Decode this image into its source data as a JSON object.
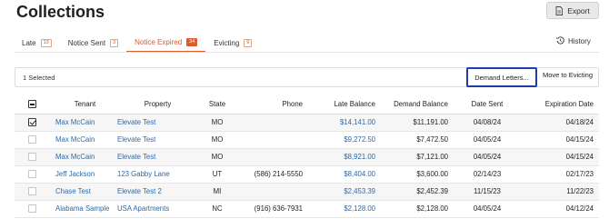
{
  "page": {
    "title": "Collections"
  },
  "toolbar": {
    "export_label": "Export",
    "export_icon": "document-export-icon"
  },
  "tabs": [
    {
      "label": "Late",
      "count": "13",
      "active": false
    },
    {
      "label": "Notice Sent",
      "count": "3",
      "active": false
    },
    {
      "label": "Notice Expired",
      "count": "34",
      "active": true
    },
    {
      "label": "Evicting",
      "count": "9",
      "active": false
    }
  ],
  "history": {
    "label": "History",
    "icon": "history-icon"
  },
  "actions": {
    "selected_text": "1 Selected",
    "demand_letters_label": "Demand Letters...",
    "move_to_evicting_label": "Move to Evicting"
  },
  "table": {
    "columns": [
      "Tenant",
      "Property",
      "State",
      "Phone",
      "Late Balance",
      "Demand Balance",
      "Date Sent",
      "Expiration Date"
    ],
    "header_checkbox_state": "partial",
    "rows": [
      {
        "checked": true,
        "tenant": "Max McCain",
        "property": "Elevate Test",
        "state": "MO",
        "phone": "",
        "late_balance": "$14,141.00",
        "demand_balance": "$11,191.00",
        "date_sent": "04/08/24",
        "expiration_date": "04/18/24"
      },
      {
        "checked": false,
        "tenant": "Max McCain",
        "property": "Elevate Test",
        "state": "MO",
        "phone": "",
        "late_balance": "$9,272.50",
        "demand_balance": "$7,472.50",
        "date_sent": "04/05/24",
        "expiration_date": "04/15/24"
      },
      {
        "checked": false,
        "tenant": "Max McCain",
        "property": "Elevate Test",
        "state": "MO",
        "phone": "",
        "late_balance": "$8,921.00",
        "demand_balance": "$7,121.00",
        "date_sent": "04/05/24",
        "expiration_date": "04/15/24"
      },
      {
        "checked": false,
        "tenant": "Jeff Jackson",
        "property": "123 Gabby Lane",
        "state": "UT",
        "phone": "(586) 214-5550",
        "late_balance": "$8,404.00",
        "demand_balance": "$3,600.00",
        "date_sent": "02/14/23",
        "expiration_date": "02/17/23"
      },
      {
        "checked": false,
        "tenant": "Chase Test",
        "property": "Elevate Test 2",
        "state": "MI",
        "phone": "",
        "late_balance": "$2,453.39",
        "demand_balance": "$2,452.39",
        "date_sent": "11/15/23",
        "expiration_date": "11/22/23"
      },
      {
        "checked": false,
        "tenant": "Alabama Sample",
        "property": "USA Apartments",
        "state": "NC",
        "phone": "(916) 636-7931",
        "late_balance": "$2,128.00",
        "demand_balance": "$2,128.00",
        "date_sent": "04/05/24",
        "expiration_date": "04/12/24"
      }
    ]
  },
  "colors": {
    "accent": "#e05a2b",
    "link": "#2d6aa8",
    "focus": "#1c3fa8"
  }
}
